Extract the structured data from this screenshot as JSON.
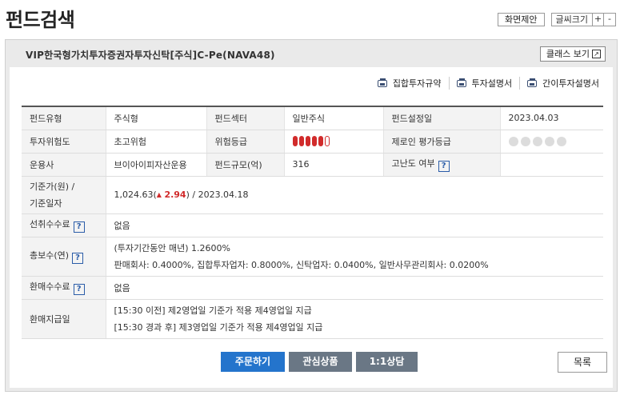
{
  "header": {
    "title": "펀드검색",
    "suggest_label": "화면제안",
    "font_size_label": "글씨크기",
    "font_plus": "+",
    "font_minus": "-"
  },
  "fund": {
    "name": "VIP한국형가치투자증권자투자신탁[주식]C-Pe(NAVA48)",
    "class_view_label": "클래스 보기",
    "class_view_arrow": "↗"
  },
  "doc_links": [
    {
      "label": "집합투자규약",
      "icon": "printer-icon"
    },
    {
      "label": "투자설명서",
      "icon": "printer-icon"
    },
    {
      "label": "간이투자설명서",
      "icon": "printer-icon"
    }
  ],
  "info": {
    "fund_type_label": "펀드유형",
    "fund_type": "주식형",
    "sector_label": "펀드섹터",
    "sector": "일반주식",
    "setup_date_label": "펀드설정일",
    "setup_date": "2023.04.03",
    "risk_label": "투자위험도",
    "risk": "초고위험",
    "risk_grade_label": "위험등급",
    "risk_grade_filled": 5,
    "risk_grade_total": 6,
    "zeroin_label": "제로인 평가등급",
    "zeroin_rating_filled": 0,
    "zeroin_rating_total": 5,
    "manager_label": "운용사",
    "manager": "브이아이피자산운용",
    "size_label": "펀드규모(억)",
    "size": "316",
    "difficulty_label": "고난도 여부",
    "difficulty": "",
    "nav_label_1": "기준가(원) /",
    "nav_label_2": "기준일자",
    "nav_value": "1,024.63(",
    "nav_change": "2.94",
    "nav_date": ") / 2023.04.18",
    "front_fee_label": "선취수수료",
    "front_fee": "없음",
    "total_fee_label": "총보수(연)",
    "total_fee_line1": "(투자기간동안 매년) 1.2600%",
    "total_fee_line2": "판매회사: 0.4000%, 집합투자업자: 0.8000%, 신탁업자: 0.0400%, 일반사무관리회사: 0.0200%",
    "redemption_fee_label": "환매수수료",
    "redemption_fee": "없음",
    "payment_label": "환매지급일",
    "payment_line1": "[15:30 이전] 제2영업일 기준가 적용 제4영업일 지급",
    "payment_line2": "[15:30 경과 후] 제3영업일 기준가 적용 제4영업일 지급",
    "help_glyph": "?"
  },
  "actions": {
    "order": "주문하기",
    "watch": "관심상품",
    "consult": "1:1상담",
    "list": "목록"
  },
  "colors": {
    "accent_blue": "#2474cc",
    "button_gray": "#6a7785",
    "risk_red": "#d12b2b"
  }
}
